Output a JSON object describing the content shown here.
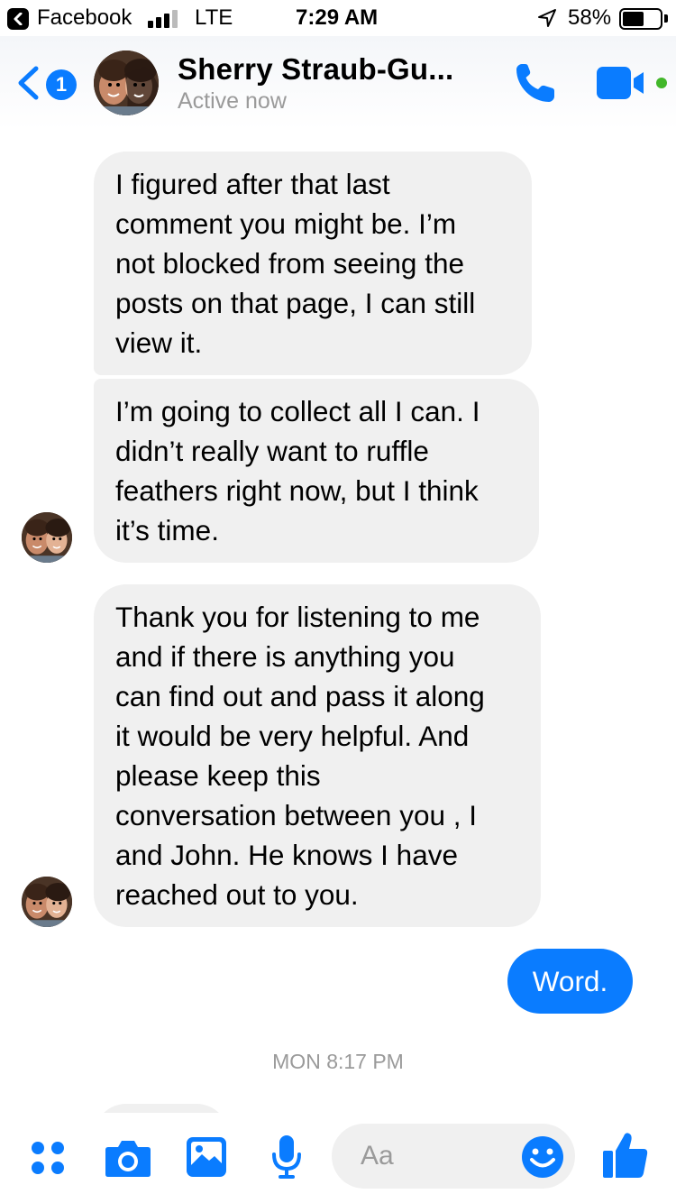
{
  "status_bar": {
    "back_app": "Facebook",
    "network": "LTE",
    "time": "7:29 AM",
    "battery": "58%",
    "battery_level": 0.58
  },
  "header": {
    "unread_badge": "1",
    "contact_name": "Sherry Straub-Gu...",
    "contact_status": "Active now",
    "accent_color": "#0a7cff",
    "online_color": "#42b72a"
  },
  "messages": [
    {
      "from": "contact",
      "text": "I figured after that last\ncomment you might be. I’m\nnot blocked from seeing the\nposts on that page, I can still\nview it."
    },
    {
      "from": "contact",
      "text": "I’m going to collect all I can. I\ndidn’t really want to ruffle\nfeathers right now, but I think\nit’s time."
    },
    {
      "from": "contact",
      "text": "Thank you for listening to me\nand if there is anything you\ncan find out and pass it along\nit would be very helpful. And\nplease keep this\nconversation between you , I\nand John. He knows I have\nreached out to you."
    },
    {
      "from": "me",
      "text": "Word."
    }
  ],
  "timestamp": "MON 8:17 PM",
  "composer": {
    "placeholder": "Aa",
    "icons": [
      "apps-icon",
      "camera-icon",
      "photo-icon",
      "microphone-icon",
      "emoji-icon",
      "thumbs-up-icon"
    ]
  }
}
